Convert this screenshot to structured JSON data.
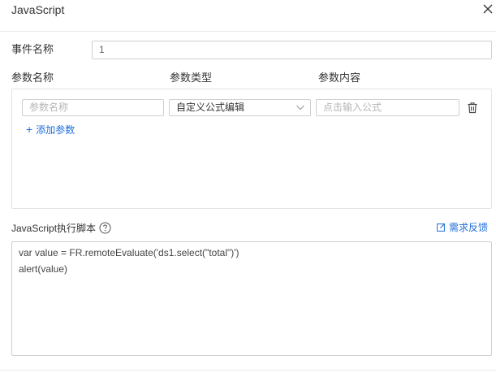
{
  "dialog": {
    "title": "JavaScript"
  },
  "event": {
    "label": "事件名称",
    "value": "1"
  },
  "params": {
    "headers": [
      "参数名称",
      "参数类型",
      "参数内容"
    ],
    "row": {
      "name_placeholder": "参数名称",
      "type_value": "自定义公式编辑",
      "content_placeholder": "点击输入公式"
    },
    "add_label": "添加参数"
  },
  "script": {
    "label": "JavaScript执行脚本",
    "feedback_label": "需求反馈",
    "lines": [
      "var value = FR.remoteEvaluate('ds1.select(\"total\")')",
      "alert(value)"
    ]
  },
  "icons": {
    "close": "close-icon",
    "chevron": "chevron-down-icon",
    "trash": "trash-icon",
    "plus": "plus-icon",
    "help": "help-icon",
    "feedback": "edit-icon"
  },
  "colors": {
    "accent": "#1e6fd9",
    "border": "#cfcfcf"
  }
}
